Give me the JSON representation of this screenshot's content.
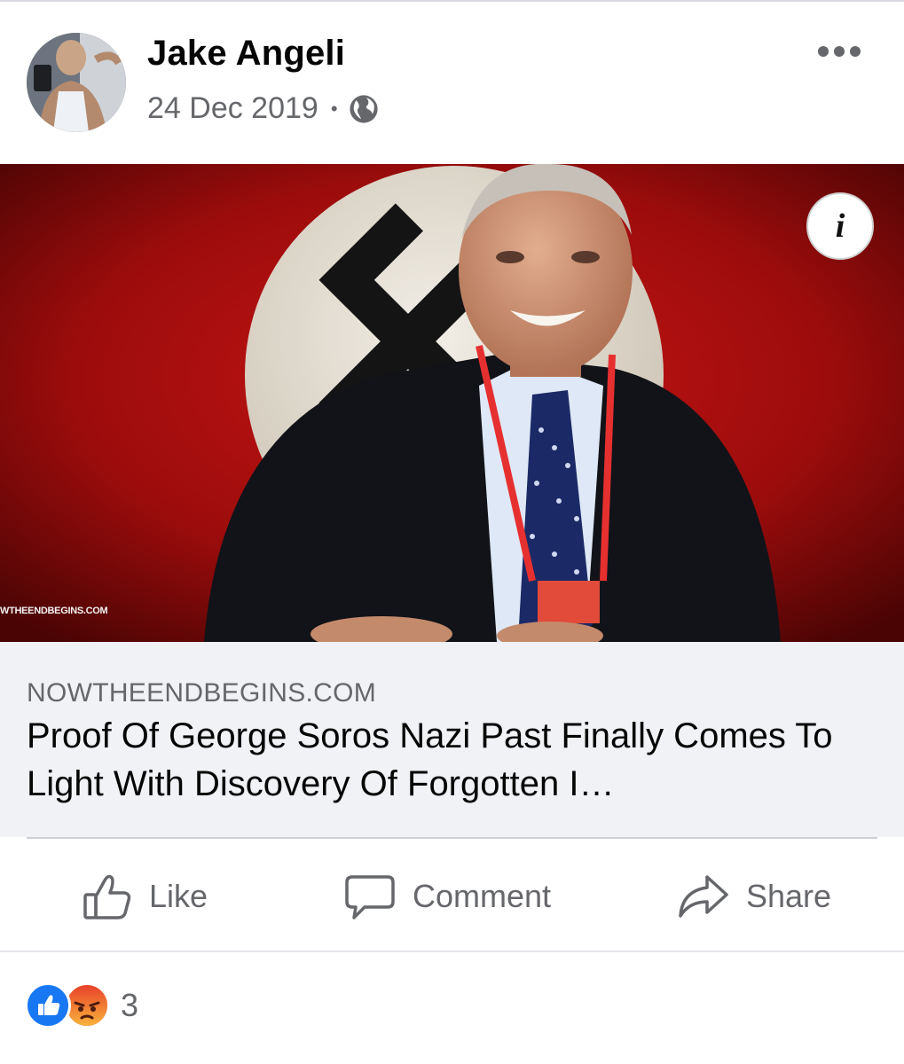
{
  "post": {
    "author": "Jake Angeli",
    "date": "24 Dec 2019",
    "separator": "•",
    "audience_icon": "globe-icon",
    "more_icon": "more-options-icon"
  },
  "link_card": {
    "image_watermark": "WTHEENDBEGINS.COM",
    "info_icon_label": "i",
    "domain": "NOWTHEENDBEGINS.COM",
    "headline": "Proof Of George Soros Nazi Past Finally Comes To Light With Discovery Of Forgotten I…"
  },
  "actions": [
    {
      "label": "Like",
      "icon": "thumbs-up-icon"
    },
    {
      "label": "Comment",
      "icon": "comment-bubble-icon"
    },
    {
      "label": "Share",
      "icon": "share-arrow-icon"
    }
  ],
  "reactions": {
    "types": [
      "like",
      "angry"
    ],
    "count": "3"
  },
  "colors": {
    "brand_blue": "#1877f2",
    "angry_orange": "#f0603a",
    "secondary_text": "#65676b",
    "card_background": "#f0f2f5"
  }
}
